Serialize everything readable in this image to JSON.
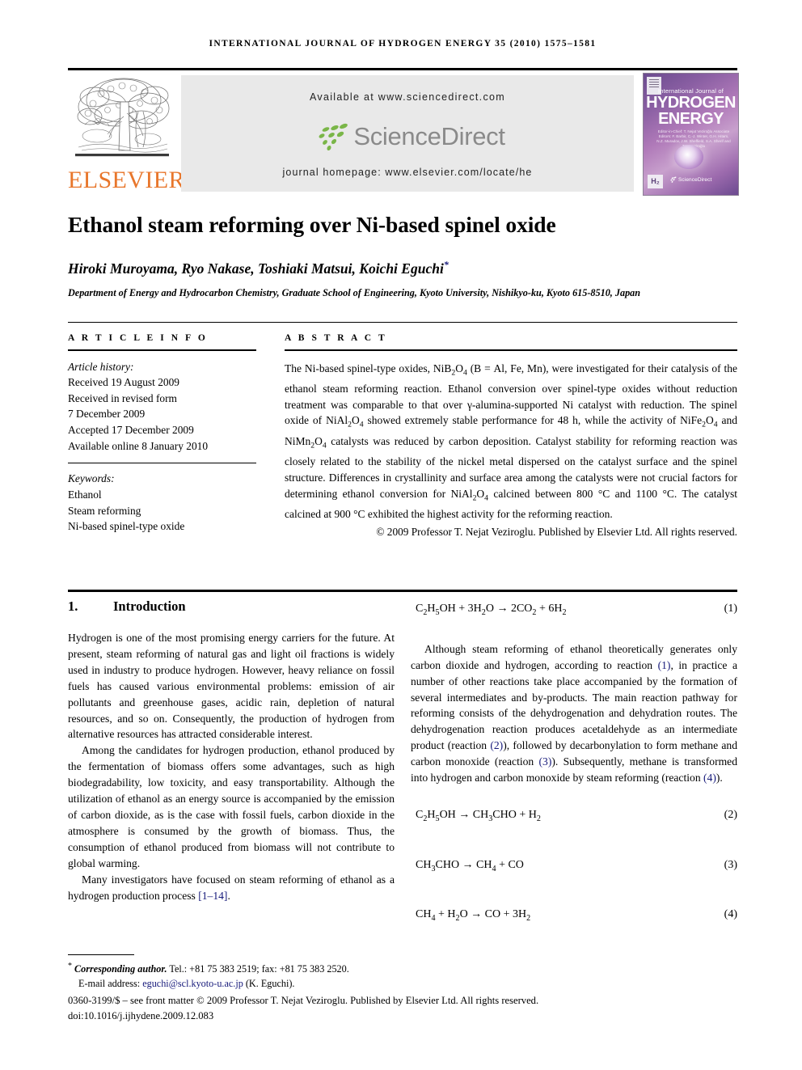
{
  "running_head": "INTERNATIONAL JOURNAL OF HYDROGEN ENERGY 35 (2010) 1575–1581",
  "header": {
    "elsevier_wordmark": "ELSEVIER",
    "available_at": "Available at www.sciencedirect.com",
    "sciencedirect_wordmark": "ScienceDirect",
    "journal_homepage": "journal homepage: www.elsevier.com/locate/he",
    "cover": {
      "kicker": "International Journal of",
      "line1": "HYDROGEN",
      "line2": "ENERGY",
      "editors": "Editor-in-Chief: T. Nejat Veziroğlu   Associate Editors: F. Barbir, C.-J. Winter, G.H. Hitam, N.Z. Muradov, J.W. Sheffield, S.A. Sherif and T.N. Veziroğlu",
      "he_badge": "H₂",
      "sciencedirect_badge": "ScienceDirect"
    }
  },
  "article": {
    "title": "Ethanol steam reforming over Ni-based spinel oxide",
    "authors": "Hiroki Muroyama, Ryo Nakase, Toshiaki Matsui, Koichi Eguchi",
    "corresponding_marker": "*",
    "affiliation": "Department of Energy and Hydrocarbon Chemistry, Graduate School of Engineering, Kyoto University, Nishikyo-ku, Kyoto 615-8510, Japan"
  },
  "article_info": {
    "heading": "A R T I C L E   I N F O",
    "history_label": "Article history:",
    "history": [
      "Received 19 August 2009",
      "Received in revised form",
      "7 December 2009",
      "Accepted 17 December 2009",
      "Available online 8 January 2010"
    ],
    "keywords_label": "Keywords:",
    "keywords": [
      "Ethanol",
      "Steam reforming",
      "Ni-based spinel-type oxide"
    ]
  },
  "abstract": {
    "heading": "A B S T R A C T",
    "text": "The Ni-based spinel-type oxides, NiB2O4 (B = Al, Fe, Mn), were investigated for their catalysis of the ethanol steam reforming reaction. Ethanol conversion over spinel-type oxides without reduction treatment was comparable to that over γ-alumina-supported Ni catalyst with reduction. The spinel oxide of NiAl2O4 showed extremely stable performance for 48 h, while the activity of NiFe2O4 and NiMn2O4 catalysts was reduced by carbon deposition. Catalyst stability for reforming reaction was closely related to the stability of the nickel metal dispersed on the catalyst surface and the spinel structure. Differences in crystallinity and surface area among the catalysts were not crucial factors for determining ethanol conversion for NiAl2O4 calcined between 800 °C and 1100 °C. The catalyst calcined at 900 °C exhibited the highest activity for the reforming reaction.",
    "copyright": "© 2009 Professor T. Nejat Veziroglu. Published by Elsevier Ltd. All rights reserved."
  },
  "body": {
    "section_number": "1.",
    "section_title": "Introduction",
    "paragraphs": [
      "Hydrogen is one of the most promising energy carriers for the future. At present, steam reforming of natural gas and light oil fractions is widely used in industry to produce hydrogen. However, heavy reliance on fossil fuels has caused various environmental problems: emission of air pollutants and greenhouse gases, acidic rain, depletion of natural resources, and so on. Consequently, the production of hydrogen from alternative resources has attracted considerable interest.",
      "Among the candidates for hydrogen production, ethanol produced by the fermentation of biomass offers some advantages, such as high biodegradability, low toxicity, and easy transportability. Although the utilization of ethanol as an energy source is accompanied by the emission of carbon dioxide, as is the case with fossil fuels, carbon dioxide in the atmosphere is consumed by the growth of biomass. Thus, the consumption of ethanol produced from biomass will not contribute to global warming."
    ],
    "last_paragraph_pre": "Many investigators have focused on steam reforming of ethanol as a hydrogen production process ",
    "last_paragraph_ref": "[1–14]",
    "last_paragraph_post": ".",
    "right_paragraph_1a": "Although steam reforming of ethanol theoretically generates only carbon dioxide and hydrogen, according to reaction ",
    "right_ref_1": "(1)",
    "right_paragraph_1b": ", in practice a number of other reactions take place accompanied by the formation of several intermediates and by-products. The main reaction pathway for reforming consists of the dehydrogenation and dehydration routes. The dehydrogenation reaction produces acetaldehyde as an intermediate product (reaction ",
    "right_ref_2": "(2)",
    "right_paragraph_1c": "), followed by decarbonylation to form methane and carbon monoxide (reaction ",
    "right_ref_3": "(3)",
    "right_paragraph_1d": "). Subsequently, methane is transformed into hydrogen and carbon monoxide by steam reforming (reaction ",
    "right_ref_4": "(4)",
    "right_paragraph_1e": ")."
  },
  "equations": [
    {
      "id": "eq1",
      "expr": "C2H5OH + 3H2O → 2CO2 + 6H2",
      "number": "(1)"
    },
    {
      "id": "eq2",
      "expr": "C2H5OH → CH3CHO + H2",
      "number": "(2)"
    },
    {
      "id": "eq3",
      "expr": "CH3CHO → CH4 + CO",
      "number": "(3)"
    },
    {
      "id": "eq4",
      "expr": "CH4 + H2O → CO + 3H2",
      "number": "(4)"
    }
  ],
  "footnotes": {
    "corresponding_label": "Corresponding author.",
    "corresponding_rest": " Tel.: +81 75 383 2519; fax: +81 75 383 2520.",
    "email_label": "E-mail address: ",
    "email": "eguchi@scl.kyoto-u.ac.jp",
    "email_rest": " (K. Eguchi).",
    "issn_line": "0360-3199/$ – see front matter © 2009 Professor T. Nejat Veziroglu. Published by Elsevier Ltd. All rights reserved.",
    "doi_line": "doi:10.1016/j.ijhydene.2009.12.083"
  },
  "colors": {
    "elsevier_orange": "#E8762B",
    "sciencedirect_green": "#7AB648",
    "link_navy": "#16197a",
    "band_gray": "#e9e9e9"
  }
}
